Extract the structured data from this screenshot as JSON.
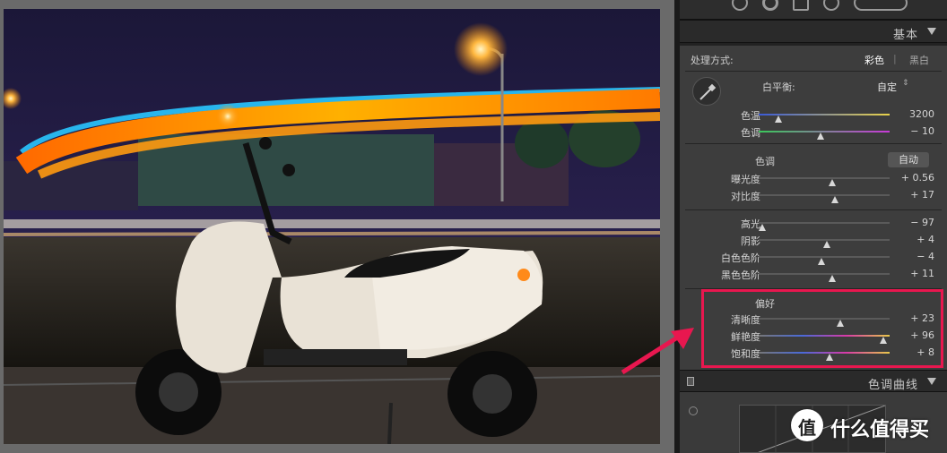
{
  "panel": {
    "basic_title": "基本",
    "treatment": {
      "label": "处理方式:",
      "color": "彩色",
      "sep": "|",
      "bw": "黑白"
    },
    "white_balance": {
      "label": "白平衡:",
      "value": "自定"
    },
    "wb_sliders": [
      {
        "label": "色温",
        "value": "3200",
        "pos": 0.15
      },
      {
        "label": "色调",
        "value": "− 10",
        "pos": 0.47
      }
    ],
    "tone": {
      "label": "色调",
      "auto": "自动"
    },
    "tone_sliders": [
      {
        "label": "曝光度",
        "value": "+ 0.56",
        "pos": 0.56
      },
      {
        "label": "对比度",
        "value": "+ 17",
        "pos": 0.58
      }
    ],
    "light_sliders": [
      {
        "label": "高光",
        "value": "− 97",
        "pos": 0.03
      },
      {
        "label": "阴影",
        "value": "+ 4",
        "pos": 0.52
      },
      {
        "label": "白色色阶",
        "value": "− 4",
        "pos": 0.48
      },
      {
        "label": "黑色色阶",
        "value": "+ 11",
        "pos": 0.56
      }
    ],
    "presence": {
      "label": "偏好"
    },
    "presence_sliders": [
      {
        "label": "清晰度",
        "value": "+ 23",
        "pos": 0.62
      },
      {
        "label": "鲜艳度",
        "value": "+ 96",
        "pos": 0.95
      },
      {
        "label": "饱和度",
        "value": "+ 8",
        "pos": 0.54
      }
    ],
    "curve_title": "色调曲线"
  },
  "watermark": {
    "logo": "值",
    "text": "什么值得买"
  },
  "colors": {
    "highlight": "#e8174f",
    "trail_orange": "#ff8a00",
    "trail_cyan": "#29c6ff"
  }
}
